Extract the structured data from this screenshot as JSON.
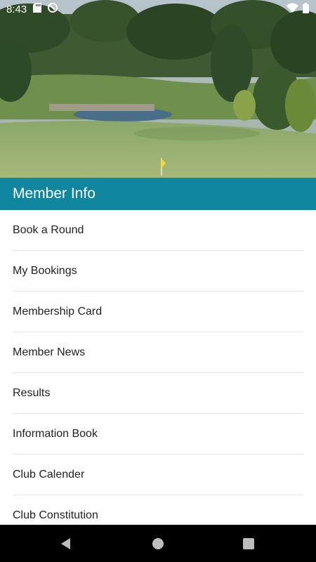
{
  "status_bar": {
    "time": "8:43",
    "left_icons": [
      "sd-card-icon",
      "data-saver-icon"
    ],
    "right_icons": [
      "wifi-icon",
      "battery-icon"
    ]
  },
  "hero": {
    "description_icon": "golf-course-photo"
  },
  "header": {
    "title": "Member Info",
    "color": "#11879f"
  },
  "menu": {
    "items": [
      {
        "label": "Book a Round"
      },
      {
        "label": "My Bookings"
      },
      {
        "label": "Membership Card"
      },
      {
        "label": "Member News"
      },
      {
        "label": "Results"
      },
      {
        "label": "Information Book"
      },
      {
        "label": "Club Calender"
      },
      {
        "label": "Club Constitution"
      }
    ]
  },
  "nav_bar": {
    "buttons": [
      "back-icon",
      "home-icon",
      "recents-icon"
    ]
  }
}
